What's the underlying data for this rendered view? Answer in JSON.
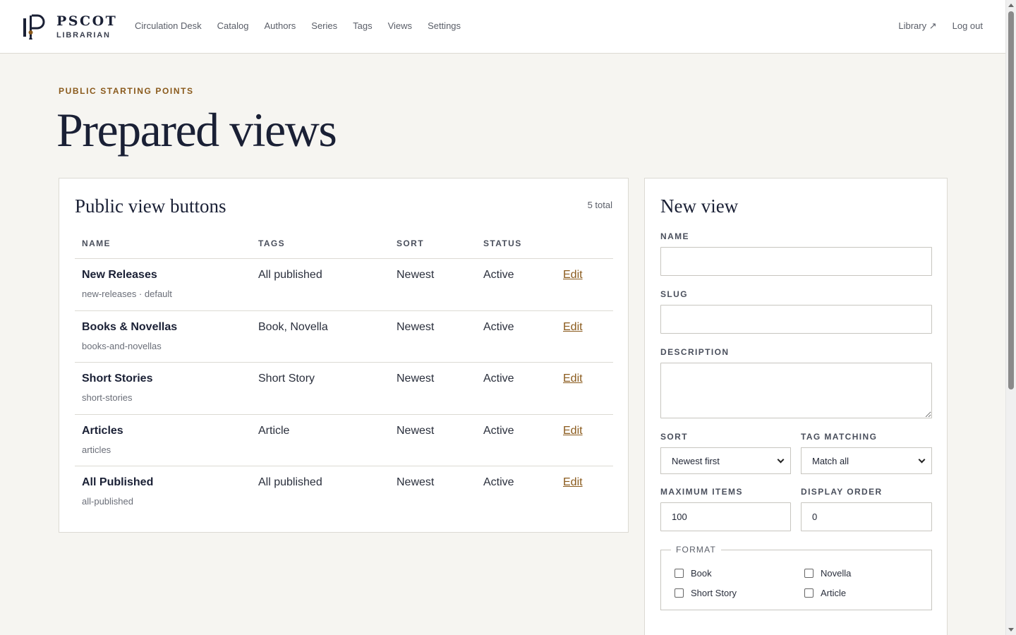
{
  "brand": {
    "name": "PSCOT",
    "sub": "LIBRARIAN"
  },
  "nav": {
    "items": [
      "Circulation Desk",
      "Catalog",
      "Authors",
      "Series",
      "Tags",
      "Views",
      "Settings"
    ],
    "library": "Library ↗",
    "logout": "Log out"
  },
  "page": {
    "eyebrow": "PUBLIC STARTING POINTS",
    "title": "Prepared views"
  },
  "list": {
    "title": "Public view buttons",
    "total": "5 total",
    "headers": [
      "NAME",
      "TAGS",
      "SORT",
      "STATUS"
    ],
    "rows": [
      {
        "name": "New Releases",
        "sub": "new-releases · default",
        "tags": "All published",
        "sort": "Newest",
        "status": "Active",
        "action": "Edit"
      },
      {
        "name": "Books & Novellas",
        "sub": "books-and-novellas",
        "tags": "Book, Novella",
        "sort": "Newest",
        "status": "Active",
        "action": "Edit"
      },
      {
        "name": "Short Stories",
        "sub": "short-stories",
        "tags": "Short Story",
        "sort": "Newest",
        "status": "Active",
        "action": "Edit"
      },
      {
        "name": "Articles",
        "sub": "articles",
        "tags": "Article",
        "sort": "Newest",
        "status": "Active",
        "action": "Edit"
      },
      {
        "name": "All Published",
        "sub": "all-published",
        "tags": "All published",
        "sort": "Newest",
        "status": "Active",
        "action": "Edit"
      }
    ]
  },
  "form": {
    "title": "New view",
    "name_label": "NAME",
    "name_value": "",
    "slug_label": "SLUG",
    "slug_value": "",
    "description_label": "DESCRIPTION",
    "description_value": "",
    "sort_label": "SORT",
    "sort_value": "Newest first",
    "tag_matching_label": "TAG MATCHING",
    "tag_matching_value": "Match all",
    "max_items_label": "MAXIMUM ITEMS",
    "max_items_value": "100",
    "display_order_label": "DISPLAY ORDER",
    "display_order_value": "0",
    "format_legend": "FORMAT",
    "formats": [
      "Book",
      "Novella",
      "Short Story",
      "Article"
    ]
  },
  "colors": {
    "accent": "#8a5a1c",
    "ink": "#1a2035",
    "background": "#f6f5f1"
  }
}
